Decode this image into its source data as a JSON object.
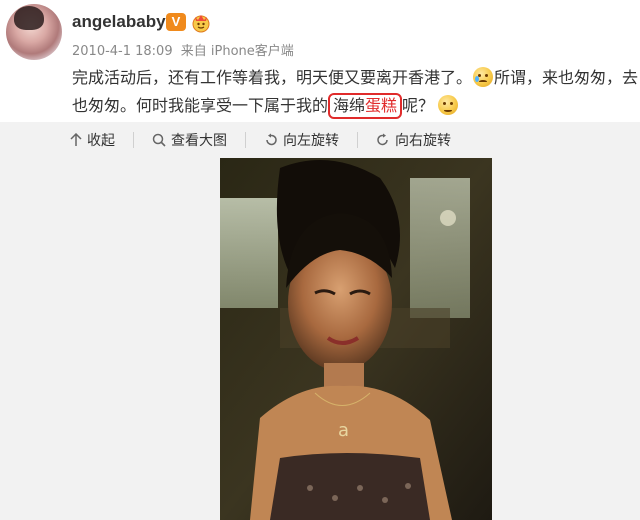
{
  "post": {
    "username": "angelababy",
    "verified_badge": "V",
    "timestamp": "2010-4-1 18:09",
    "source": "来自 iPhone客户端",
    "text": {
      "line1_a": "完成活动后，还有工作等着我，明天便又要离开香港了。",
      "line1_b": "所谓，来也匆匆，去",
      "line2_a": "也匆匆。何时我能享受一下属于我的",
      "highlight_a": "海绵",
      "highlight_b": "蛋糕",
      "line2_b": "呢？"
    }
  },
  "toolbar": {
    "collapse_label": "收起",
    "view_large_label": "查看大图",
    "rotate_left_label": "向左旋转",
    "rotate_right_label": "向右旋转"
  },
  "icons": {
    "collapse": "arrow-up-icon",
    "view_large": "magnifier-icon",
    "rotate_left": "rotate-left-icon",
    "rotate_right": "rotate-right-icon",
    "crying_emoji": "crying-face-emoji",
    "sad_emoji": "sad-face-emoji"
  },
  "colors": {
    "verified": "#f08a1c",
    "highlight": "#e02b2b",
    "toolbar_bg": "#f2f2f2"
  }
}
